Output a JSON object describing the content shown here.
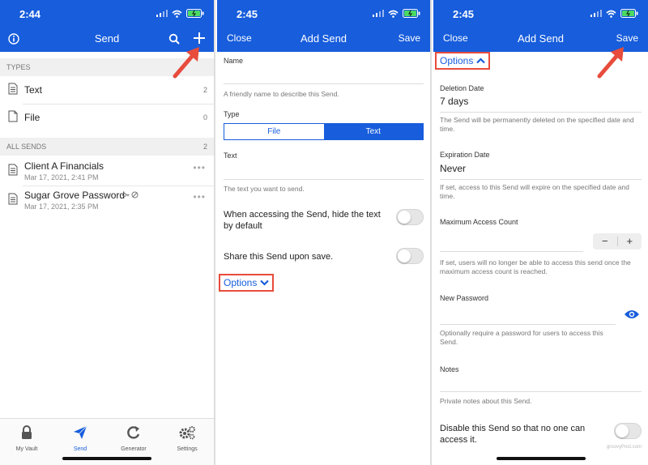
{
  "panel1": {
    "time": "2:44",
    "title": "Send",
    "sections": {
      "types": "TYPES",
      "all_sends": "ALL SENDS",
      "all_sends_count": "2"
    },
    "types": [
      {
        "label": "Text",
        "count": "2"
      },
      {
        "label": "File",
        "count": "0"
      }
    ],
    "sends": [
      {
        "name": "Client A Financials",
        "date": "Mar 17, 2021, 2:41 PM"
      },
      {
        "name": "Sugar Grove Password",
        "date": "Mar 17, 2021, 2:35 PM"
      }
    ],
    "tabs": [
      {
        "label": "My Vault"
      },
      {
        "label": "Send"
      },
      {
        "label": "Generator"
      },
      {
        "label": "Settings"
      }
    ]
  },
  "panel2": {
    "time": "2:45",
    "title": "Add Send",
    "close": "Close",
    "save": "Save",
    "name_label": "Name",
    "name_hint": "A friendly name to describe this Send.",
    "type_label": "Type",
    "type_file": "File",
    "type_text": "Text",
    "text_label": "Text",
    "text_hint": "The text you want to send.",
    "hide_text_toggle": "When accessing the Send, hide the text by default",
    "share_toggle": "Share this Send upon save.",
    "options": "Options"
  },
  "panel3": {
    "time": "2:45",
    "title": "Add Send",
    "close": "Close",
    "save": "Save",
    "options": "Options",
    "deletion_label": "Deletion Date",
    "deletion_value": "7 days",
    "deletion_hint": "The Send will be permanently deleted on the specified date and time.",
    "expiration_label": "Expiration Date",
    "expiration_value": "Never",
    "expiration_hint": "If set, access to this Send will expire on the specified date and time.",
    "max_access_label": "Maximum Access Count",
    "max_access_hint": "If set, users will no longer be able to access this send once the maximum access count is reached.",
    "stepper_minus": "−",
    "stepper_plus": "+",
    "password_label": "New Password",
    "password_hint": "Optionally require a password for users to access this Send.",
    "notes_label": "Notes",
    "notes_hint": "Private notes about this Send.",
    "disable_toggle": "Disable this Send so that no one can access it.",
    "watermark": "groovyPost.com"
  },
  "colors": {
    "brand": "#175ddc",
    "highlight": "#e74c3c"
  }
}
